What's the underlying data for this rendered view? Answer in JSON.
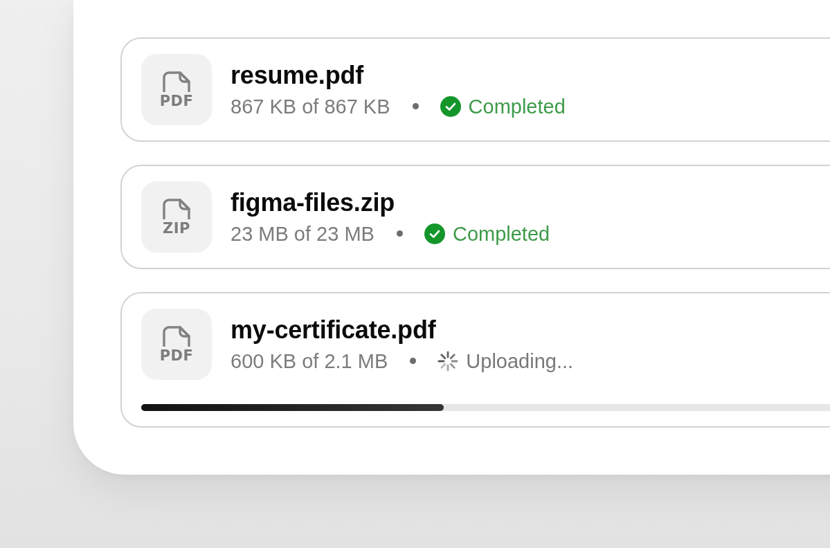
{
  "uploads": [
    {
      "type_label": "PDF",
      "name": "resume.pdf",
      "size": "867 KB of 867 KB",
      "status": {
        "kind": "completed",
        "label": "Completed"
      }
    },
    {
      "type_label": "ZIP",
      "name": "figma-files.zip",
      "size": "23 MB of 23 MB",
      "status": {
        "kind": "completed",
        "label": "Completed"
      }
    },
    {
      "type_label": "PDF",
      "name": "my-certificate.pdf",
      "size": "600 KB of 2.1 MB",
      "status": {
        "kind": "uploading",
        "label": "Uploading..."
      },
      "progress": {
        "level": 0.3
      }
    }
  ]
}
